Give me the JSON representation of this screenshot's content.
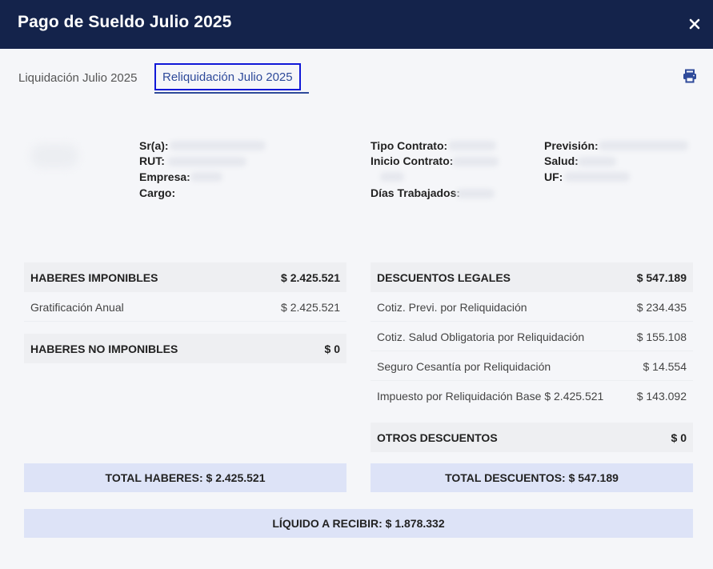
{
  "header": {
    "title": "Pago de Sueldo Julio 2025"
  },
  "tabs": [
    {
      "label": "Liquidación Julio 2025"
    },
    {
      "label": "Reliquidación Julio 2025"
    }
  ],
  "employee_info": {
    "sr_label": "Sr(a):",
    "rut_label": "RUT:",
    "empresa_label": "Empresa:",
    "cargo_label": "Cargo:",
    "tipo_contrato_label": "Tipo Contrato:",
    "inicio_contrato_label": "Inicio Contrato:",
    "dias_trabajados_label": "Días Trabajados:",
    "prevision_label": "Previsión:",
    "salud_label": "Salud:",
    "uf_label": "UF:"
  },
  "haberes_imponibles": {
    "title": "HABERES IMPONIBLES",
    "total": "$ 2.425.521",
    "items": [
      {
        "label": "Gratificación Anual",
        "value": "$ 2.425.521"
      }
    ]
  },
  "haberes_no_imponibles": {
    "title": "HABERES NO IMPONIBLES",
    "total": "$ 0"
  },
  "descuentos_legales": {
    "title": "DESCUENTOS LEGALES",
    "total": "$ 547.189",
    "items": [
      {
        "label": "Cotiz. Previ. por Reliquidación",
        "value": "$ 234.435"
      },
      {
        "label": "Cotiz. Salud Obligatoria por Reliquidación",
        "value": "$ 155.108"
      },
      {
        "label": "Seguro Cesantía por Reliquidación",
        "value": "$ 14.554"
      },
      {
        "label": "Impuesto por Reliquidación Base $ 2.425.521",
        "value": "$ 143.092"
      }
    ]
  },
  "otros_descuentos": {
    "title": "OTROS DESCUENTOS",
    "total": "$ 0"
  },
  "totals": {
    "haberes": "TOTAL HABERES: $ 2.425.521",
    "descuentos": "TOTAL DESCUENTOS: $ 547.189",
    "liquido": "LÍQUIDO A RECIBIR: $ 1.878.332"
  },
  "icons": {
    "close": "close-icon",
    "print": "printer-icon"
  },
  "colors": {
    "header_bg": "#14234b",
    "accent": "#2e4a9a",
    "total_bg": "#dde3f7"
  }
}
